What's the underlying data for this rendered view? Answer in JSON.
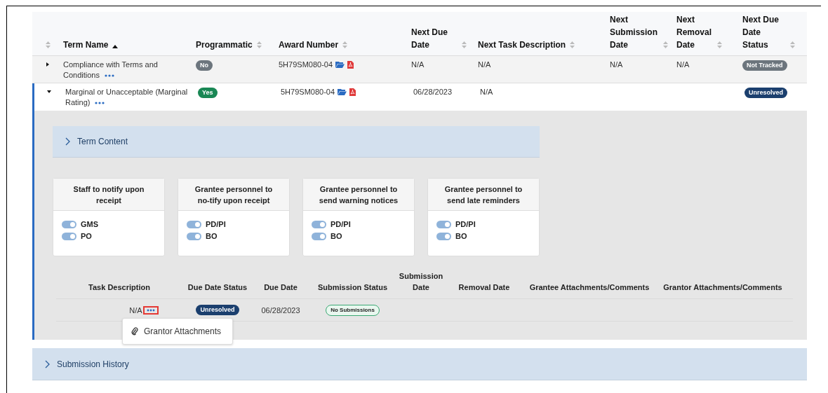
{
  "table": {
    "columns": [
      {
        "sorted_ascending": false
      },
      {
        "label": "Term Name",
        "sorted_ascending": true
      },
      {
        "label": "Programmatic",
        "sorted_ascending": false
      },
      {
        "label": "Award Number",
        "sorted_ascending": false
      },
      {
        "label": "Next Due Date",
        "sorted_ascending": false
      },
      {
        "label": "Next Task Description",
        "sorted_ascending": false
      },
      {
        "label": "Next Submission Date",
        "sorted_ascending": false
      },
      {
        "label": "Next Removal Date",
        "sorted_ascending": false
      },
      {
        "label": "Next Due Date Status",
        "sorted_ascending": false
      }
    ],
    "rows": [
      {
        "expanded": false,
        "term_name": "Compliance with Terms and Conditions",
        "programmatic": {
          "text": "No",
          "color": "#6c757d"
        },
        "award_number": "5H79SM080-04",
        "next_due_date": "N/A",
        "next_task_description": "N/A",
        "next_submission_date": "N/A",
        "next_removal_date": "N/A",
        "status": {
          "text": "Not Tracked",
          "color": "#6c757d"
        }
      },
      {
        "expanded": true,
        "term_name": "Marginal or Unacceptable (Marginal Rating)",
        "programmatic": {
          "text": "Yes",
          "color": "#198754"
        },
        "award_number": "5H79SM080-04",
        "next_due_date": "06/28/2023",
        "next_task_description": "N/A",
        "status": {
          "text": "Unresolved",
          "color": "#1b3f6e"
        }
      }
    ]
  },
  "detail": {
    "term_content": {
      "label": "Term Content",
      "expanded": false
    },
    "cards": [
      {
        "title": "Staff to notify upon receipt",
        "toggles": [
          {
            "label": "GMS",
            "on": true
          },
          {
            "label": "PO",
            "on": true
          }
        ]
      },
      {
        "title": "Grantee personnel to no-tify upon receipt",
        "toggles": [
          {
            "label": "PD/PI",
            "on": true
          },
          {
            "label": "BO",
            "on": true
          }
        ]
      },
      {
        "title": "Grantee personnel to send warning notices",
        "toggles": [
          {
            "label": "PD/PI",
            "on": true
          },
          {
            "label": "BO",
            "on": true
          }
        ]
      },
      {
        "title": "Grantee personnel to send late reminders",
        "toggles": [
          {
            "label": "PD/PI",
            "on": true
          },
          {
            "label": "BO",
            "on": true
          }
        ]
      }
    ],
    "tasks": {
      "columns": [
        "Task Description",
        "Due Date Status",
        "Due Date",
        "Submission Status",
        "Submission Date",
        "Removal Date",
        "Grantee Attachments/Comments",
        "Grantor Attachments/Comments"
      ],
      "rows": [
        {
          "task_description": "N/A",
          "menu_open": true,
          "due_date_status": {
            "text": "Unresolved",
            "color": "#1b3f6e"
          },
          "due_date": "06/28/2023",
          "submission_status": {
            "text": "No Submissions",
            "color": "#3aa873"
          },
          "menu": [
            {
              "label": "Grantor Attachments"
            }
          ]
        }
      ]
    }
  },
  "submission_history": {
    "label": "Submission History",
    "expanded": false
  }
}
